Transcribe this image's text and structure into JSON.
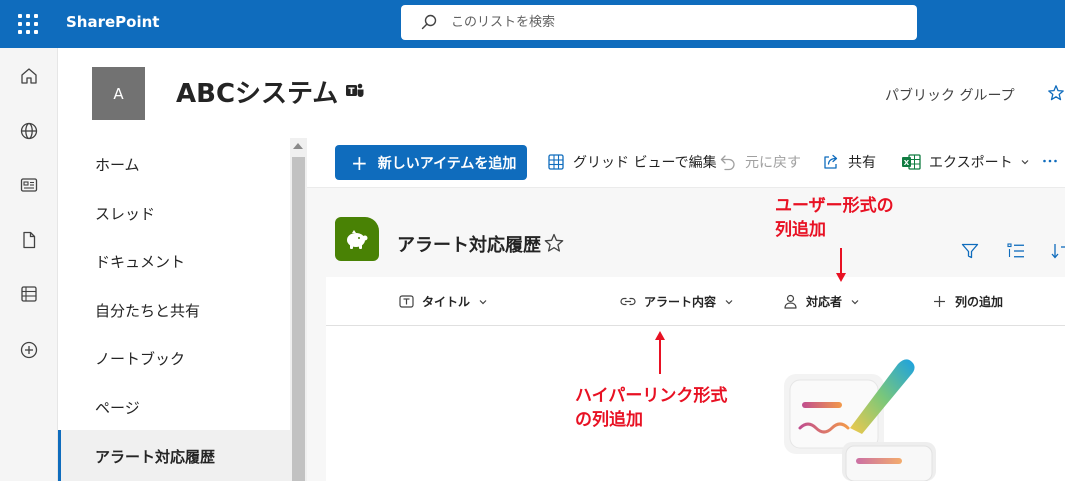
{
  "suitebar": {
    "brand": "SharePoint",
    "search_placeholder": "このリストを検索"
  },
  "site": {
    "logo_letter": "A",
    "title": "ABCシステム",
    "group_type": "パブリック グループ"
  },
  "nav": {
    "items": [
      {
        "label": "ホーム"
      },
      {
        "label": "スレッド"
      },
      {
        "label": "ドキュメント"
      },
      {
        "label": "自分たちと共有"
      },
      {
        "label": "ノートブック"
      },
      {
        "label": "ページ"
      },
      {
        "label": "アラート対応履歴",
        "selected": true
      }
    ]
  },
  "command_bar": {
    "new_item": "新しいアイテムを追加",
    "grid_edit": "グリッド ビューで編集",
    "undo": "元に戻す",
    "share": "共有",
    "export": "エクスポート"
  },
  "list": {
    "title": "アラート対応履歴",
    "columns": [
      {
        "label": "タイトル",
        "icon": "text-icon"
      },
      {
        "label": "アラート内容",
        "icon": "link-icon"
      },
      {
        "label": "対応者",
        "icon": "person-icon"
      },
      {
        "label": "列の追加",
        "icon": "plus-icon"
      }
    ]
  },
  "annotations": {
    "user_column": [
      "ユーザー形式の",
      "列追加"
    ],
    "hyperlink_column": [
      "ハイパーリンク形式",
      "の列追加"
    ]
  },
  "colors": {
    "suitebar": "#0f6cbd",
    "primary_button": "#0f6cbd",
    "list_icon": "#498205",
    "annotation": "#e81123"
  }
}
